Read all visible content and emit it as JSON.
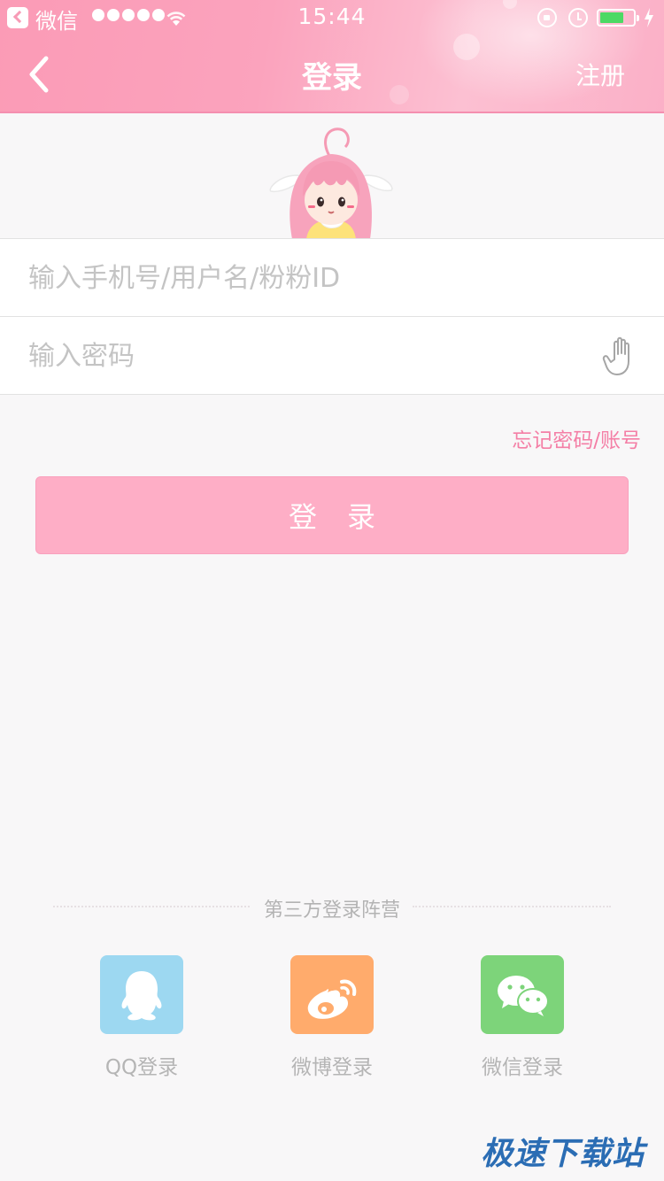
{
  "status_bar": {
    "back_app": "微信",
    "time": "15:44",
    "battery_level": 0.72,
    "battery_color": "#4cd964"
  },
  "nav": {
    "back_icon": "chevron-left-icon",
    "title": "登录",
    "register": "注册"
  },
  "mascot": {
    "icon": "anime-girl-mascot"
  },
  "form": {
    "account_placeholder": "输入手机号/用户名/粉粉ID",
    "account_value": "",
    "password_placeholder": "输入密码",
    "password_value": "",
    "password_toggle_icon": "hand-icon",
    "forgot": "忘记密码/账号",
    "login_button": "登录"
  },
  "third_party": {
    "title": "第三方登录阵营",
    "items": [
      {
        "label": "QQ登录",
        "icon": "qq-icon",
        "color": "#9dd8f1"
      },
      {
        "label": "微博登录",
        "icon": "weibo-icon",
        "color": "#ffab6c"
      },
      {
        "label": "微信登录",
        "icon": "wechat-icon",
        "color": "#7dd47a"
      }
    ]
  },
  "watermark": "极速下载站",
  "colors": {
    "accent": "#f47fa6",
    "header": "#fba3bd",
    "button": "#feaec6"
  }
}
